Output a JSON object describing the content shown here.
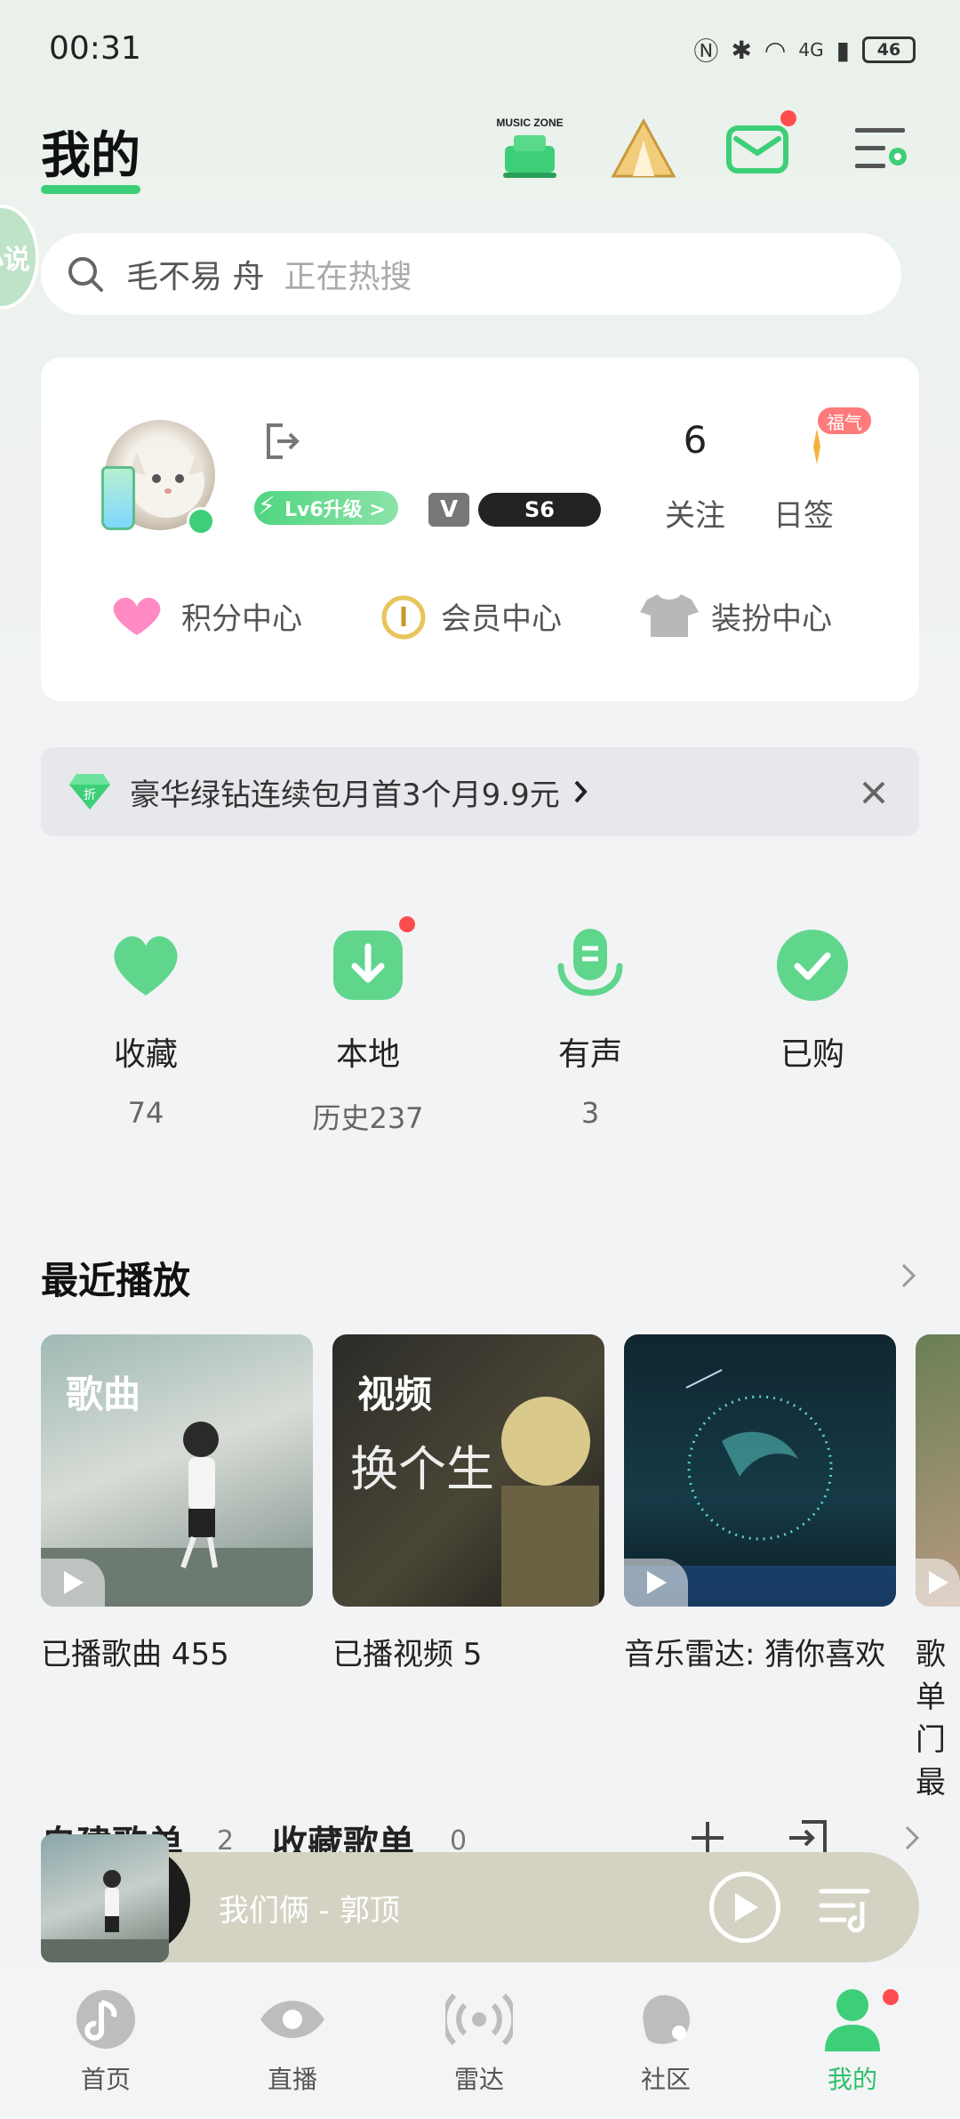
{
  "status_bar": {
    "time": "00:31",
    "network": "4G",
    "battery": "46"
  },
  "header": {
    "title": "我的",
    "music_zone_label": "MUSIC ZONE"
  },
  "side_bubble": {
    "text": "小说"
  },
  "search": {
    "query": "毛不易 舟",
    "hint": "正在热搜"
  },
  "profile": {
    "level_badge": "Lv6升级 >",
    "v_badge": "V",
    "s_badge": "S6",
    "follow_count": "6",
    "follow_label": "关注",
    "fuqi_badge": "福气",
    "checkin_label": "日签",
    "links": [
      "积分中心",
      "会员中心",
      "装扮中心"
    ]
  },
  "promo": {
    "text": "豪华绿钻连续包月首3个月9.9元",
    "discount_tag": "折"
  },
  "quick_actions": [
    {
      "label": "收藏",
      "count": "74",
      "icon": "heart-icon",
      "has_dot": false
    },
    {
      "label": "本地",
      "count": "历史237",
      "icon": "download-icon",
      "has_dot": true
    },
    {
      "label": "有声",
      "count": "3",
      "icon": "microphone-icon",
      "has_dot": false
    },
    {
      "label": "已购",
      "count": "",
      "icon": "check-icon",
      "has_dot": false
    }
  ],
  "recent": {
    "title": "最近播放",
    "cards": [
      {
        "tag": "歌曲",
        "label": "已播歌曲 455"
      },
      {
        "tag": "视频",
        "overlay": "换个生",
        "label": "已播视频 5"
      },
      {
        "tag": "",
        "label": "音乐雷达: 猜你喜欢"
      },
      {
        "tag": "",
        "label": "歌单 门最"
      }
    ]
  },
  "playlists": {
    "tabs": [
      {
        "label": "自建歌单",
        "count": "2"
      },
      {
        "label": "收藏歌单",
        "count": "0"
      }
    ]
  },
  "mini_player": {
    "title": "我们俩 - 郭顶"
  },
  "bottom_nav": [
    {
      "label": "首页",
      "icon": "home-note-icon"
    },
    {
      "label": "直播",
      "icon": "eye-icon"
    },
    {
      "label": "雷达",
      "icon": "radar-icon"
    },
    {
      "label": "社区",
      "icon": "community-icon"
    },
    {
      "label": "我的",
      "icon": "person-icon",
      "active": true
    }
  ],
  "colors": {
    "accent": "#3dcf78",
    "active_nav": "#2fbf69",
    "dot": "#ff4d4f"
  }
}
